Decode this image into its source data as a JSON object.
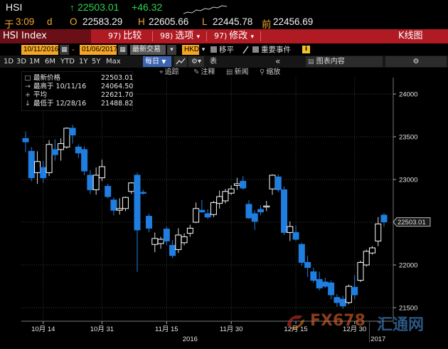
{
  "quote": {
    "ticker": "HSI",
    "arrow": "↑",
    "last": "22503.01",
    "change": "+46.32",
    "time_label": "于",
    "time": "3:09",
    "day_flag": "d",
    "open_label": "O",
    "open": "22583.29",
    "high_label": "H",
    "high": "22605.66",
    "low_label": "L",
    "low": "22445.78",
    "prev_label": "前",
    "prev": "22456.69"
  },
  "toolbar": {
    "ticker": "HSI Index",
    "compare_num": "97)",
    "compare_label": "比较",
    "options_num": "98)",
    "options_label": "选项",
    "options_caret": "▾",
    "modify_num": "97)",
    "modify_label": "修改",
    "modify_caret": "▾",
    "chart_type": "K线图"
  },
  "controls": {
    "start_date": "10/11/2016",
    "end_date": "01/06/2017",
    "date_sep": "-",
    "period": "最新交易",
    "currency": "HKD",
    "shift_label": "移平",
    "events_label": "重要事件",
    "info_icon_text": "i"
  },
  "zoom": {
    "ranges": [
      "1D",
      "3D",
      "1M",
      "6M",
      "YTD",
      "1Y",
      "5Y",
      "Max"
    ],
    "frequency": "每日",
    "caret": "▼",
    "table_label": "表",
    "chart_content_label": "图表内容",
    "gear": "⚙"
  },
  "tools": {
    "track": "追踪",
    "annotate": "注释",
    "news": "新闻",
    "zoom": "缩放"
  },
  "legend": [
    {
      "symbol": "□",
      "label": "最新价格",
      "value": "22503.01"
    },
    {
      "symbol": "→",
      "label": "最高于 10/11/16",
      "value": "24064.50"
    },
    {
      "symbol": "+",
      "label": "平均",
      "value": "22621.70"
    },
    {
      "symbol": "↓",
      "label": "最低于 12/28/16",
      "value": "21488.82"
    }
  ],
  "colors": {
    "up": "#ffffff",
    "down": "#1f7ee0",
    "accent": "#f4a72c",
    "toolbar_red": "#b01a23"
  },
  "chart_data": {
    "type": "candlestick",
    "ylim": [
      21350,
      24300
    ],
    "yticks": [
      21500,
      22000,
      22500,
      23000,
      23500,
      24000
    ],
    "current_price_label": "22503.01",
    "current_price": 22503.01,
    "x_ticks": [
      {
        "label": "10月 14",
        "index": 3
      },
      {
        "label": "10月 31",
        "index": 13
      },
      {
        "label": "11月 15",
        "index": 24
      },
      {
        "label": "11月 30",
        "index": 35
      },
      {
        "label": "12月 15",
        "index": 46
      },
      {
        "label": "12月 30",
        "index": 56
      }
    ],
    "year_labels": [
      {
        "label": "2016",
        "index": 28
      },
      {
        "label": "2017",
        "index": 60
      }
    ],
    "candles": [
      {
        "o": 23480,
        "h": 23560,
        "l": 23320,
        "c": 23440
      },
      {
        "o": 23330,
        "h": 23380,
        "l": 22980,
        "c": 23020
      },
      {
        "o": 23080,
        "h": 23330,
        "l": 22950,
        "c": 23210
      },
      {
        "o": 23140,
        "h": 23220,
        "l": 22960,
        "c": 23020
      },
      {
        "o": 23080,
        "h": 23460,
        "l": 23040,
        "c": 23410
      },
      {
        "o": 23350,
        "h": 23470,
        "l": 23220,
        "c": 23290
      },
      {
        "o": 23350,
        "h": 23480,
        "l": 23220,
        "c": 23420
      },
      {
        "o": 23380,
        "h": 23610,
        "l": 23360,
        "c": 23600
      },
      {
        "o": 23600,
        "h": 23640,
        "l": 23420,
        "c": 23520
      },
      {
        "o": 23380,
        "h": 23410,
        "l": 23250,
        "c": 23310
      },
      {
        "o": 23350,
        "h": 23390,
        "l": 23050,
        "c": 23100
      },
      {
        "o": 23050,
        "h": 23110,
        "l": 22830,
        "c": 22880
      },
      {
        "o": 22880,
        "h": 23140,
        "l": 22820,
        "c": 23050
      },
      {
        "o": 23020,
        "h": 23230,
        "l": 22980,
        "c": 23150
      },
      {
        "o": 22920,
        "h": 22950,
        "l": 22780,
        "c": 22800
      },
      {
        "o": 22760,
        "h": 22790,
        "l": 22580,
        "c": 22640
      },
      {
        "o": 22640,
        "h": 22780,
        "l": 22590,
        "c": 22660
      },
      {
        "o": 22660,
        "h": 22800,
        "l": 22630,
        "c": 22790
      },
      {
        "o": 22860,
        "h": 22970,
        "l": 22830,
        "c": 22960
      },
      {
        "o": 23050,
        "h": 23080,
        "l": 21920,
        "c": 22410
      },
      {
        "o": 22850,
        "h": 22880,
        "l": 22820,
        "c": 22840
      },
      {
        "o": 22570,
        "h": 22600,
        "l": 22380,
        "c": 22430
      },
      {
        "o": 22240,
        "h": 22380,
        "l": 22150,
        "c": 22310
      },
      {
        "o": 22250,
        "h": 22330,
        "l": 22190,
        "c": 22300
      },
      {
        "o": 22420,
        "h": 22450,
        "l": 22230,
        "c": 22280
      },
      {
        "o": 22230,
        "h": 22290,
        "l": 22080,
        "c": 22110
      },
      {
        "o": 22180,
        "h": 22430,
        "l": 22140,
        "c": 22350
      },
      {
        "o": 22260,
        "h": 22370,
        "l": 22230,
        "c": 22330
      },
      {
        "o": 22370,
        "h": 22470,
        "l": 22330,
        "c": 22430
      },
      {
        "o": 22500,
        "h": 22730,
        "l": 22490,
        "c": 22660
      },
      {
        "o": 22640,
        "h": 22760,
        "l": 22610,
        "c": 22620
      },
      {
        "o": 22600,
        "h": 22650,
        "l": 22540,
        "c": 22560
      },
      {
        "o": 22590,
        "h": 22750,
        "l": 22560,
        "c": 22730
      },
      {
        "o": 22720,
        "h": 22870,
        "l": 22660,
        "c": 22800
      },
      {
        "o": 22750,
        "h": 22890,
        "l": 22720,
        "c": 22860
      },
      {
        "o": 22840,
        "h": 22930,
        "l": 22820,
        "c": 22890
      },
      {
        "o": 22930,
        "h": 23020,
        "l": 22880,
        "c": 22950
      },
      {
        "o": 22980,
        "h": 23040,
        "l": 22880,
        "c": 22900
      },
      {
        "o": 22710,
        "h": 22760,
        "l": 22540,
        "c": 22550
      },
      {
        "o": 22600,
        "h": 22640,
        "l": 22410,
        "c": 22510
      },
      {
        "o": 22650,
        "h": 22700,
        "l": 22580,
        "c": 22620
      },
      {
        "o": 22680,
        "h": 22750,
        "l": 22630,
        "c": 22690
      },
      {
        "o": 22890,
        "h": 23060,
        "l": 22820,
        "c": 23050
      },
      {
        "o": 23030,
        "h": 23060,
        "l": 22850,
        "c": 22880
      },
      {
        "o": 22880,
        "h": 22920,
        "l": 22350,
        "c": 22380
      },
      {
        "o": 22380,
        "h": 22510,
        "l": 22280,
        "c": 22450
      },
      {
        "o": 22380,
        "h": 22460,
        "l": 22280,
        "c": 22300
      },
      {
        "o": 22240,
        "h": 22260,
        "l": 21990,
        "c": 22030
      },
      {
        "o": 22030,
        "h": 22110,
        "l": 21860,
        "c": 21970
      },
      {
        "o": 21920,
        "h": 21970,
        "l": 21790,
        "c": 21820
      },
      {
        "o": 21830,
        "h": 21920,
        "l": 21700,
        "c": 21730
      },
      {
        "o": 21800,
        "h": 21850,
        "l": 21730,
        "c": 21750
      },
      {
        "o": 21790,
        "h": 21820,
        "l": 21600,
        "c": 21650
      },
      {
        "o": 21620,
        "h": 21660,
        "l": 21510,
        "c": 21560
      },
      {
        "o": 21600,
        "h": 21640,
        "l": 21489,
        "c": 21520
      },
      {
        "o": 21560,
        "h": 21770,
        "l": 21540,
        "c": 21750
      },
      {
        "o": 21740,
        "h": 21880,
        "l": 21600,
        "c": 21650
      },
      {
        "o": 21820,
        "h": 22050,
        "l": 21800,
        "c": 22030
      },
      {
        "o": 22000,
        "h": 22180,
        "l": 21980,
        "c": 22160
      },
      {
        "o": 22140,
        "h": 22220,
        "l": 22120,
        "c": 22200
      },
      {
        "o": 22280,
        "h": 22560,
        "l": 22220,
        "c": 22480
      },
      {
        "o": 22583,
        "h": 22606,
        "l": 22446,
        "c": 22503
      }
    ]
  },
  "watermark": {
    "brand": "FX678",
    "name": "汇通网"
  }
}
